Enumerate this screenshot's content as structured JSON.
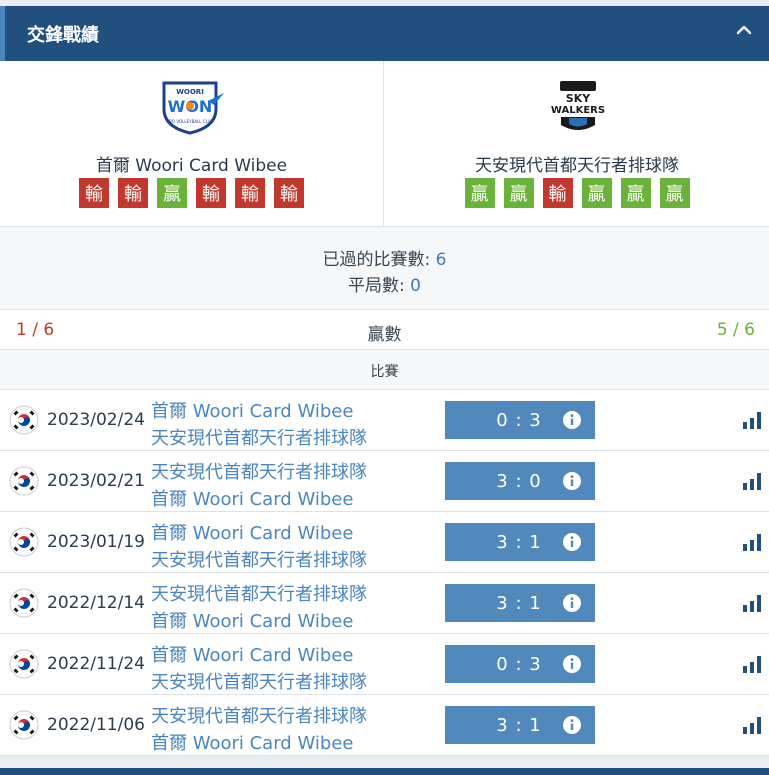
{
  "header": {
    "title": "交鋒戰績",
    "collapse_icon": "chevron-up-icon"
  },
  "teams": {
    "home": {
      "name": "首爾 Woori Card Wibee",
      "form": [
        "輸",
        "輸",
        "贏",
        "輸",
        "輸",
        "輸"
      ],
      "logo_text": "WOORI WON"
    },
    "away": {
      "name": "天安現代首都天行者排球隊",
      "form": [
        "贏",
        "贏",
        "輸",
        "贏",
        "贏",
        "贏"
      ],
      "logo_text": "SKY WALKERS"
    }
  },
  "summary": {
    "played_label": "已過的比賽數: ",
    "played_value": "6",
    "draws_label": "平局數: ",
    "draws_value": "0"
  },
  "wins": {
    "left": "1 / 6",
    "label": "贏數",
    "right": "5 / 6"
  },
  "section_label": "比賽",
  "colors": {
    "header": "#21507e",
    "loss": "#c0382e",
    "win": "#6ab23a",
    "score_bg": "#5189bd",
    "link": "#4b86bf"
  },
  "matches": [
    {
      "date": "2023/02/24",
      "team1": "首爾 Woori Card Wibee",
      "team2": "天安現代首都天行者排球隊",
      "score": "0 : 3"
    },
    {
      "date": "2023/02/21",
      "team1": "天安現代首都天行者排球隊",
      "team2": "首爾 Woori Card Wibee",
      "score": "3 : 0"
    },
    {
      "date": "2023/01/19",
      "team1": "首爾 Woori Card Wibee",
      "team2": "天安現代首都天行者排球隊",
      "score": "3 : 1"
    },
    {
      "date": "2022/12/14",
      "team1": "天安現代首都天行者排球隊",
      "team2": "首爾 Woori Card Wibee",
      "score": "3 : 1"
    },
    {
      "date": "2022/11/24",
      "team1": "首爾 Woori Card Wibee",
      "team2": "天安現代首都天行者排球隊",
      "score": "0 : 3"
    },
    {
      "date": "2022/11/06",
      "team1": "天安現代首都天行者排球隊",
      "team2": "首爾 Woori Card Wibee",
      "score": "3 : 1"
    }
  ]
}
